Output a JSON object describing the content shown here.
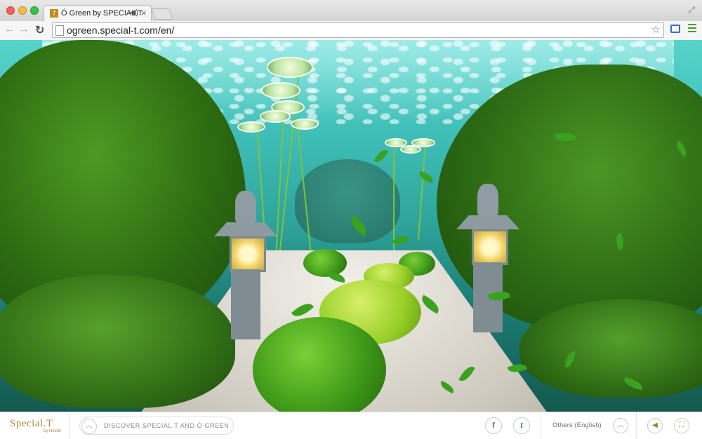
{
  "browser": {
    "tab_title": "Ó Green by SPECIAL.T",
    "tab_favicon": "T",
    "url": "ogreen.special-t.com/en/"
  },
  "icons": {
    "back": "back-arrow-icon",
    "forward": "forward-arrow-icon",
    "reload": "reload-icon",
    "star": "bookmark-star-icon",
    "cast": "cast-icon",
    "menu": "hamburger-menu-icon",
    "audio": "speaker-icon",
    "close": "close-icon"
  },
  "footer": {
    "logo": "Special.T",
    "logo_sub": "by Nestlé",
    "discover_label": "DISCOVER SPECIAL.T AND Ó GREEN",
    "facebook_label": "f",
    "twitter_label": "t",
    "language": "Others (English)"
  },
  "colors": {
    "brand_gold": "#b08a36",
    "social_blue": "#3c6cc6",
    "water": "#3fbfb8",
    "moss": "#2d6c12"
  }
}
